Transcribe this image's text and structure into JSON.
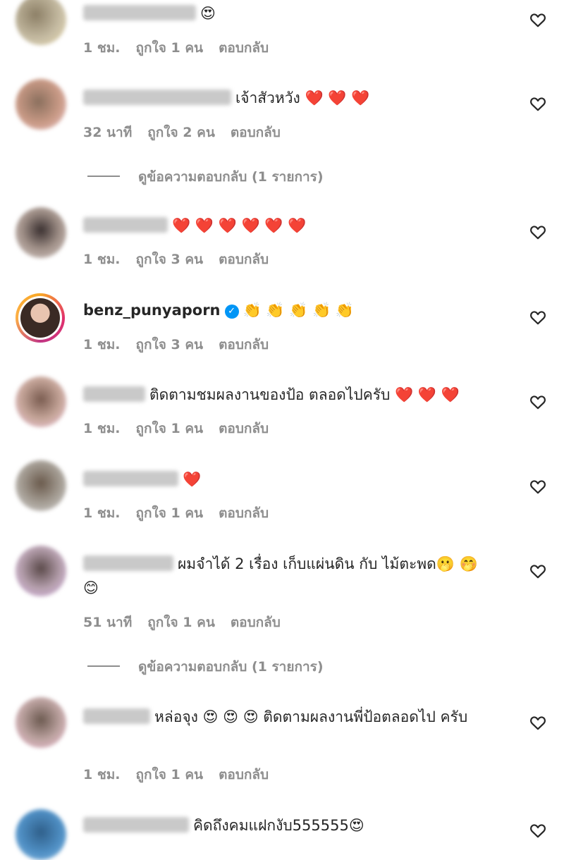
{
  "comments": [
    {
      "text": "😍",
      "time": "1 ชม.",
      "likes": "ถูกใจ 1 คน",
      "reply": "ตอบกลับ"
    },
    {
      "text": "เจ้าสัวหวัง ❤️ ❤️ ❤️",
      "time": "32 นาที",
      "likes": "ถูกใจ 2 คน",
      "reply": "ตอบกลับ"
    },
    {
      "text": "❤️ ❤️ ❤️ ❤️ ❤️ ❤️",
      "time": "1 ชม.",
      "likes": "ถูกใจ 3 คน",
      "reply": "ตอบกลับ"
    },
    {
      "username": "benz_punyaporn",
      "text": "👏 👏 👏 👏 👏",
      "time": "1 ชม.",
      "likes": "ถูกใจ 3 คน",
      "reply": "ตอบกลับ"
    },
    {
      "text": "ติดตามชมผลงานของป้อ ตลอดไปครับ ❤️ ❤️ ❤️",
      "time": "1 ชม.",
      "likes": "ถูกใจ 1 คน",
      "reply": "ตอบกลับ"
    },
    {
      "text": "❤️",
      "time": "1 ชม.",
      "likes": "ถูกใจ 1 คน",
      "reply": "ตอบกลับ"
    },
    {
      "text": "ผมจำได้ 2 เรื่อง เก็บแผ่นดิน กับ ไม้ตะพด🫢 🤭 😊",
      "time": "51 นาที",
      "likes": "ถูกใจ 1 คน",
      "reply": "ตอบกลับ"
    },
    {
      "text": "หล่อจุง 😍 😍 😍 ติดตามผลงานพี่ป้อตลอดไป ครับ",
      "time": "1 ชม.",
      "likes": "ถูกใจ 1 คน",
      "reply": "ตอบกลับ"
    },
    {
      "text": "คิดถึงคมแฝกงับ555555😍"
    }
  ],
  "view_replies": "ดูข้อความตอบกลับ (1 รายการ)",
  "icons": {
    "like": "heart-outline-icon",
    "verified": "verified-badge-icon"
  },
  "colors": {
    "meta": "#8e8e8e",
    "verified": "#0095f6"
  }
}
